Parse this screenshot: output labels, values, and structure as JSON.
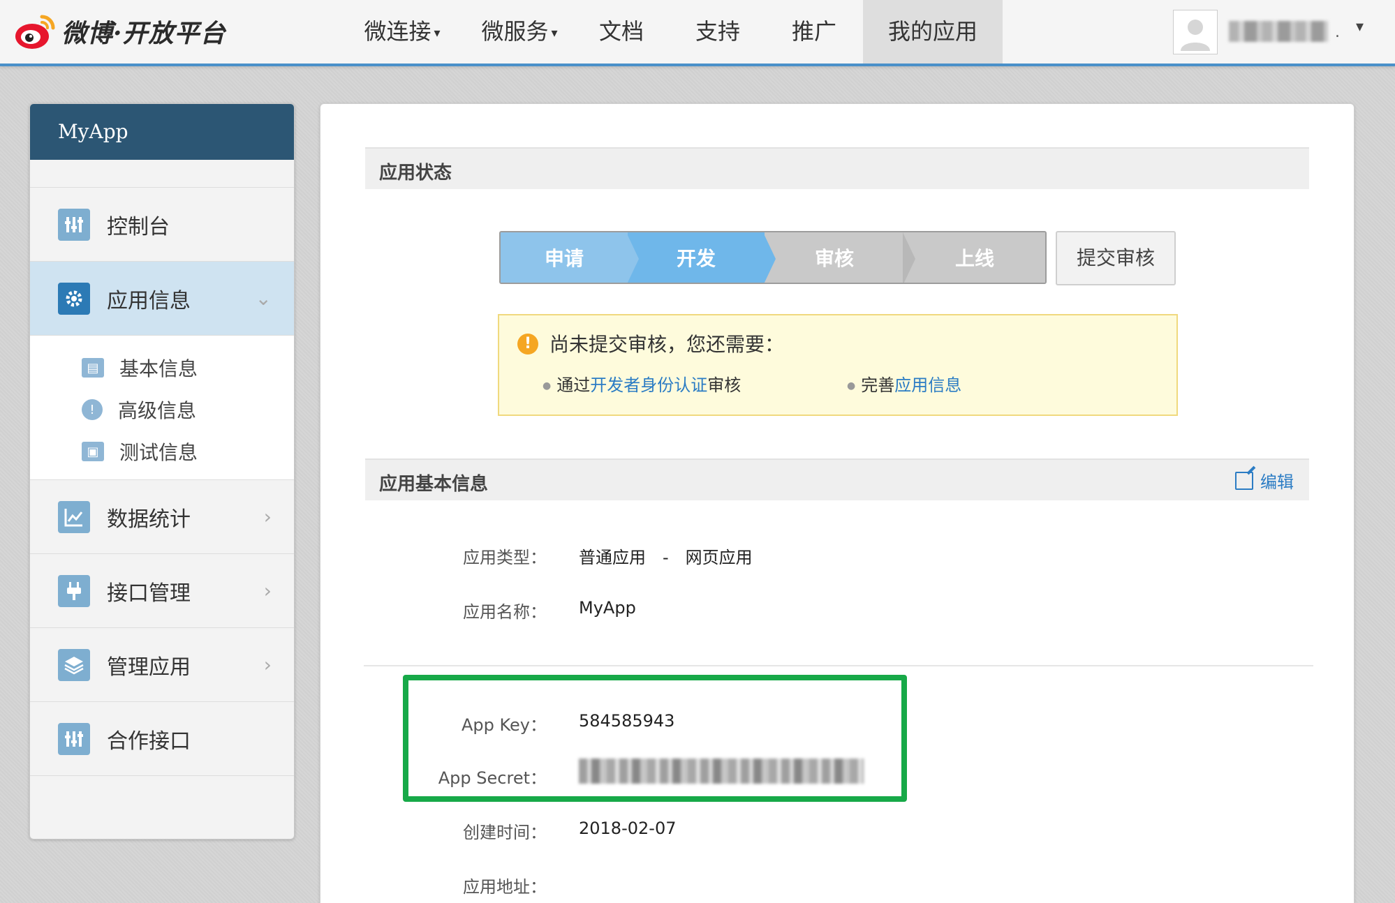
{
  "brand": {
    "logo_text": "微博·开放平台",
    "accent": "#4a90c9"
  },
  "nav": {
    "items": [
      {
        "label": "微连接",
        "caret": "▾"
      },
      {
        "label": "微服务",
        "caret": "▾"
      },
      {
        "label": "文档",
        "caret": ""
      },
      {
        "label": "支持",
        "caret": ""
      },
      {
        "label": "推广",
        "caret": ""
      },
      {
        "label": "我的应用",
        "caret": ""
      }
    ],
    "user_caret": "▾",
    "user_dot": "."
  },
  "sidebar": {
    "app_name": "MyApp",
    "items": [
      {
        "label": "控制台",
        "icon": "dashboard-icon"
      },
      {
        "label": "应用信息",
        "icon": "gear-icon",
        "arrow": "⌄"
      },
      {
        "label": "数据统计",
        "icon": "chart-icon",
        "arrow": "›"
      },
      {
        "label": "接口管理",
        "icon": "plug-icon",
        "arrow": "›"
      },
      {
        "label": "管理应用",
        "icon": "layers-icon",
        "arrow": "›"
      },
      {
        "label": "合作接口",
        "icon": "dashboard-icon"
      }
    ],
    "subitems": [
      {
        "label": "基本信息",
        "icon": "card-icon"
      },
      {
        "label": "高级信息",
        "icon": "info-icon"
      },
      {
        "label": "测试信息",
        "icon": "image-icon"
      }
    ]
  },
  "status": {
    "title": "应用状态",
    "steps": [
      "申请",
      "开发",
      "审核",
      "上线"
    ],
    "submit_label": "提交审核",
    "notice": {
      "icon": "!",
      "title": "尚未提交审核，您还需要：",
      "item1_prefix": "通过",
      "item1_link": "开发者身份认证",
      "item1_suffix": "审核",
      "item2_prefix": "完善",
      "item2_link": "应用信息"
    }
  },
  "basic": {
    "title": "应用基本信息",
    "edit_label": "编辑",
    "rows": {
      "type_label": "应用类型：",
      "type_value": "普通应用　-　网页应用",
      "name_label": "应用名称：",
      "name_value": "MyApp",
      "key_label": "App Key：",
      "key_value": "584585943",
      "secret_label": "App Secret：",
      "created_label": "创建时间：",
      "created_value": "2018-02-07",
      "url_label": "应用地址："
    }
  },
  "colors": {
    "highlight": "#17a948",
    "link": "#2b7cc4",
    "sidebar_header": "#2c5674"
  }
}
